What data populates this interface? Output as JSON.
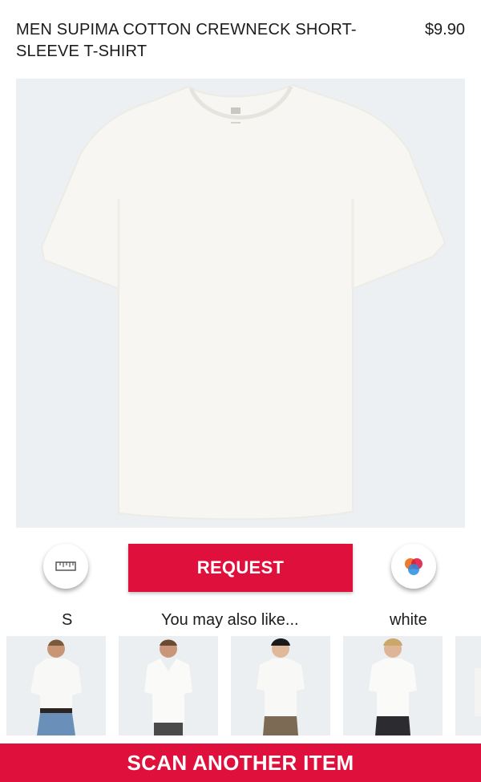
{
  "product": {
    "title": "MEN SUPIMA COTTON CREWNECK SHORT-SLEEVE T-SHIRT",
    "price": "$9.90"
  },
  "actions": {
    "size_icon": "ruler-icon",
    "request_label": "REQUEST",
    "color_icon": "color-swatch-icon"
  },
  "selection": {
    "size": "S",
    "recommend_label": "You may also like...",
    "color": "white"
  },
  "recommendations": [
    {
      "name": "white-tshirt-jeans"
    },
    {
      "name": "white-vneck-tshirt"
    },
    {
      "name": "white-crew-tshirt-shorts"
    },
    {
      "name": "white-pocket-tshirt"
    },
    {
      "name": "partial-item"
    }
  ],
  "footer": {
    "scan_label": "SCAN ANOTHER ITEM"
  },
  "colors": {
    "accent": "#e0103c",
    "image_bg": "#edf0f2",
    "shirt": "#f7f6f2"
  }
}
